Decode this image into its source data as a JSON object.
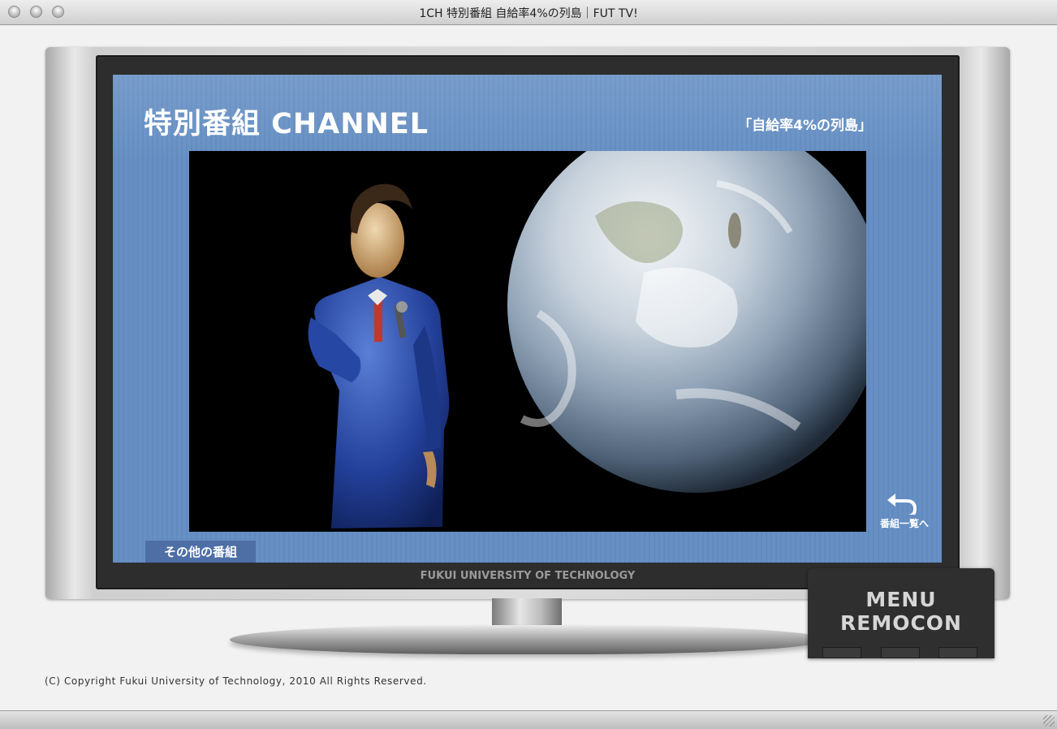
{
  "window": {
    "title": "1CH 特別番組 自給率4%の列島｜FUT TV!"
  },
  "screen": {
    "title": "特別番組 CHANNEL",
    "subtitle": "「自給率4%の列島」",
    "back_label": "番組一覧へ",
    "other_programs_label": "その他の番組"
  },
  "tv": {
    "brand": "FUKUI UNIVERSITY OF TECHNOLOGY"
  },
  "remocon": {
    "line1": "MENU",
    "line2": "REMOCON"
  },
  "footer": {
    "copyright": "(C) Copyright Fukui University of Technology, 2010 All Rights Reserved."
  },
  "colors": {
    "screen_blue": "#6690c5",
    "button_blue": "#4e6ea6",
    "bezel": "#2d2d2d"
  },
  "icons": {
    "back": "return-arrow-icon",
    "window_controls": "traffic-light-icon"
  }
}
